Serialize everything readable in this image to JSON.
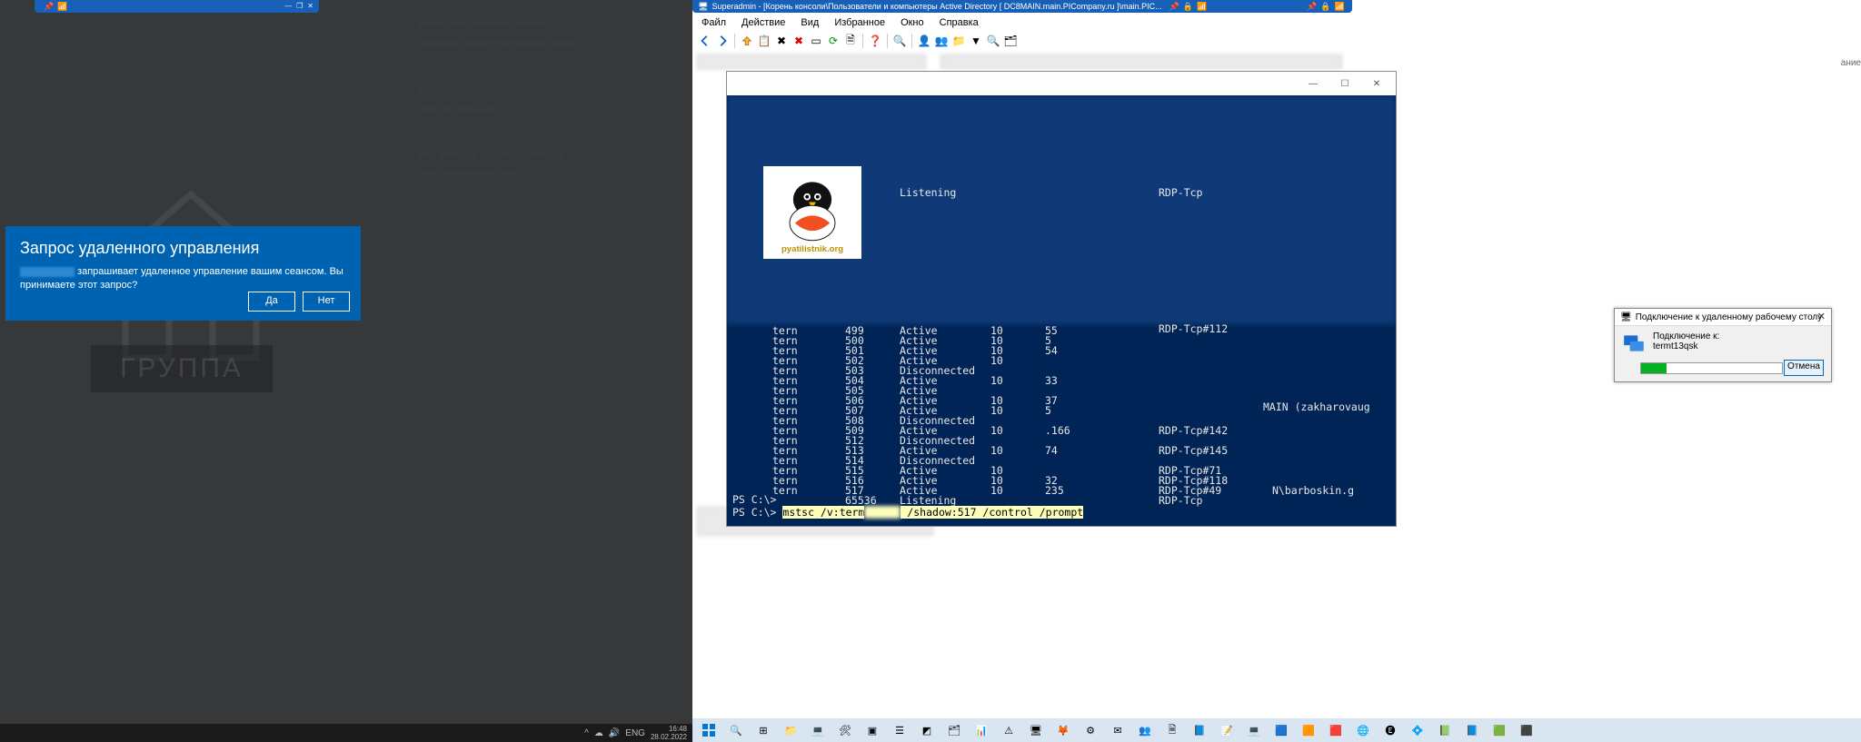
{
  "left": {
    "dialog": {
      "title": "Запрос удаленного управления",
      "message_suffix": " запрашивает удаленное управление вашим сеансом. Вы принимаете этот запрос?",
      "yes": "Да",
      "no": "Нет"
    },
    "bg_word": "ГРУППА",
    "tray": {
      "lang": "ENG",
      "time": "16:48",
      "date": "28.02.2022"
    }
  },
  "right": {
    "titlebar": "Superadmin - [Корень консоли\\Пользователи и компьютеры Active Directory [ DC8MAIN.main.PICompany.ru ]\\main.PIC...",
    "menu": [
      "Файл",
      "Действие",
      "Вид",
      "Избранное",
      "Окно",
      "Справка"
    ],
    "column": "ание",
    "rdp": {
      "title": "Подключение к удаленному рабочему столу",
      "label": "Подключение к:",
      "host": "termt13qsk",
      "cancel": "Отмена"
    },
    "ps_rows": [
      {
        "c1": "tern",
        "c2": "499",
        "c3": "Active",
        "c4": "10",
        "c5": "55",
        "c6": "",
        "c7": ""
      },
      {
        "c1": "tern",
        "c2": "500",
        "c3": "Active",
        "c4": "10",
        "c5": "5",
        "c6": "",
        "c7": ""
      },
      {
        "c1": "tern",
        "c2": "501",
        "c3": "Active",
        "c4": "10",
        "c5": "54",
        "c6": "",
        "c7": ""
      },
      {
        "c1": "tern",
        "c2": "502",
        "c3": "Active",
        "c4": "10",
        "c5": "",
        "c6": "",
        "c7": ""
      },
      {
        "c1": "tern",
        "c2": "503",
        "c3": "Disconnected",
        "c4": "",
        "c5": "",
        "c6": "",
        "c7": ""
      },
      {
        "c1": "tern",
        "c2": "504",
        "c3": "Active",
        "c4": "10",
        "c5": "33",
        "c6": "",
        "c7": ""
      },
      {
        "c1": "tern",
        "c2": "505",
        "c3": "Active",
        "c4": "",
        "c5": "",
        "c6": "",
        "c7": ""
      },
      {
        "c1": "tern",
        "c2": "506",
        "c3": "Active",
        "c4": "10",
        "c5": "37",
        "c6": "",
        "c7": ""
      },
      {
        "c1": "tern",
        "c2": "507",
        "c3": "Active",
        "c4": "10",
        "c5": "5",
        "c6": "",
        "c7": ""
      },
      {
        "c1": "tern",
        "c2": "508",
        "c3": "Disconnected",
        "c4": "",
        "c5": "",
        "c6": "",
        "c7": ""
      },
      {
        "c1": "tern",
        "c2": "509",
        "c3": "Active",
        "c4": "10",
        "c5": ".166",
        "c6": "RDP-Tcp#142",
        "c7": ""
      },
      {
        "c1": "tern",
        "c2": "512",
        "c3": "Disconnected",
        "c4": "",
        "c5": "",
        "c6": "",
        "c7": ""
      },
      {
        "c1": "tern",
        "c2": "513",
        "c3": "Active",
        "c4": "10",
        "c5": "74",
        "c6": "RDP-Tcp#145",
        "c7": ""
      },
      {
        "c1": "tern",
        "c2": "514",
        "c3": "Disconnected",
        "c4": "",
        "c5": "",
        "c6": "",
        "c7": ""
      },
      {
        "c1": "tern",
        "c2": "515",
        "c3": "Active",
        "c4": "10",
        "c5": "",
        "c6": "RDP-Tcp#71",
        "c7": ""
      },
      {
        "c1": "tern",
        "c2": "516",
        "c3": "Active",
        "c4": "10",
        "c5": "32",
        "c6": "RDP-Tcp#118",
        "c7": ""
      },
      {
        "c1": "tern",
        "c2": "517",
        "c3": "Active",
        "c4": "10",
        "c5": "235",
        "c6": "RDP-Tcp#49",
        "c7": "N\\barboskin.g"
      },
      {
        "c1": "",
        "c2": "65536",
        "c3": "Listening",
        "c4": "",
        "c5": "",
        "c6": "RDP-Tcp",
        "c7": ""
      }
    ],
    "ps_row_top_c3": "Listening",
    "ps_row_top_c6": "RDP-Tcp",
    "ps_row_b_c6": "RDP-Tcp#112",
    "ps_user_extra": "MAIN (zakharovaug",
    "prompt1": "PS C:\\>",
    "prompt2": "PS C:\\> ",
    "cmd_a": "mstsc /v:term",
    "cmd_b": " /shadow:517 /control /prompt",
    "logo_text": "pyatilistnik.org"
  }
}
